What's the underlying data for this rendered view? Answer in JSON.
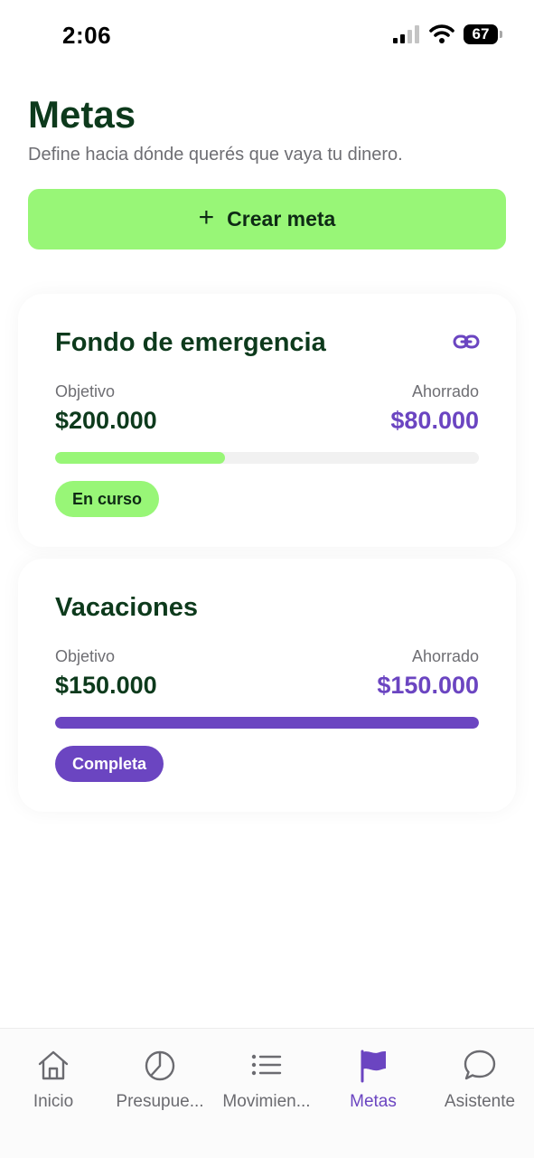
{
  "status_bar": {
    "time": "2:06",
    "battery": "67"
  },
  "header": {
    "title": "Metas",
    "subtitle": "Define hacia dónde querés que vaya tu dinero."
  },
  "create_button": {
    "label": "Crear meta",
    "icon": "plus-icon"
  },
  "goals": [
    {
      "title": "Fondo de emergencia",
      "objective_label": "Objetivo",
      "objective": "$200.000",
      "saved_label": "Ahorrado",
      "saved": "$80.000",
      "progress": 0.4,
      "status": "En curso",
      "icon": "link-icon"
    },
    {
      "title": "Vacaciones",
      "objective_label": "Objetivo",
      "objective": "$150.000",
      "saved_label": "Ahorrado",
      "saved": "$150.000",
      "progress": 1.0,
      "status": "Completa"
    }
  ],
  "colors": {
    "accent_green": "#98f677",
    "accent_purple": "#6b45c1",
    "title_green": "#0d3a1c"
  },
  "tab_bar": {
    "active": "Metas",
    "items": [
      {
        "label": "Inicio",
        "icon": "home-icon"
      },
      {
        "label": "Presupue...",
        "icon": "pie-chart-icon"
      },
      {
        "label": "Movimien...",
        "icon": "list-icon"
      },
      {
        "label": "Metas",
        "icon": "flag-icon"
      },
      {
        "label": "Asistente",
        "icon": "chat-bubble-icon"
      }
    ]
  }
}
